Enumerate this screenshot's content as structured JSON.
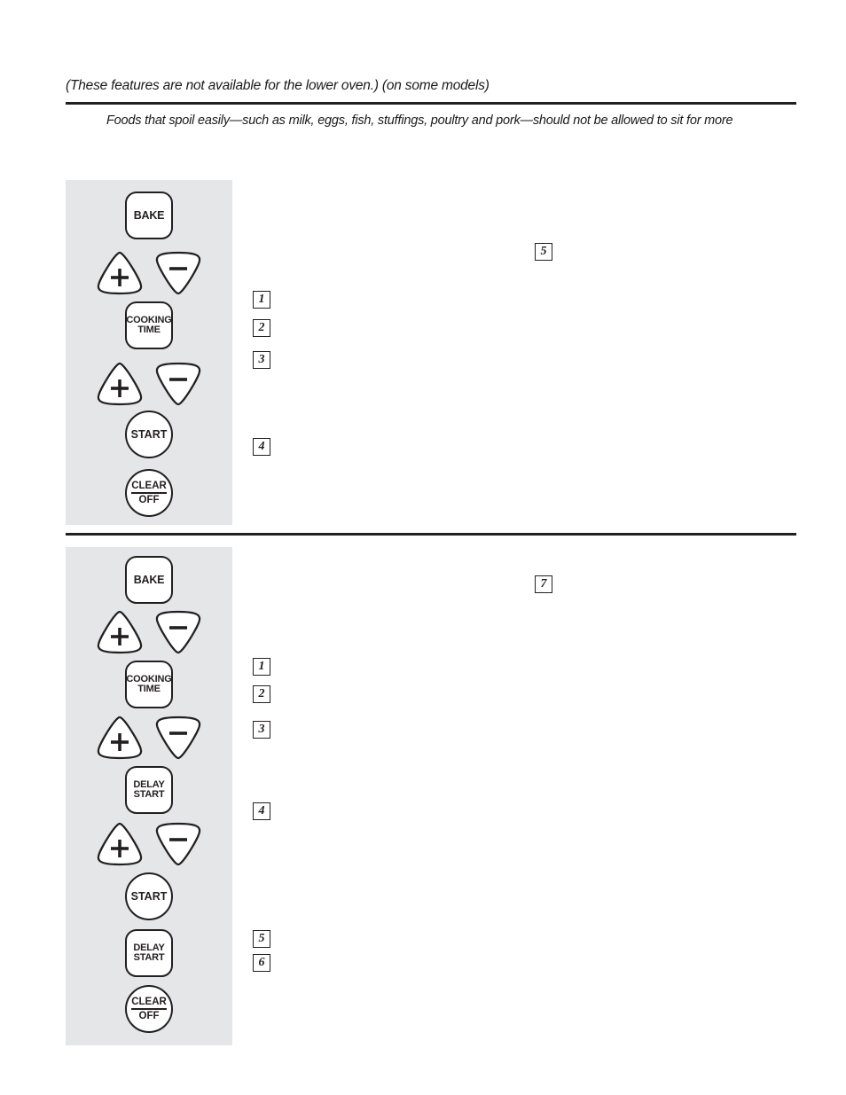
{
  "header": {
    "note": "(These features are not available for the lower oven.) (on some models)",
    "intro": "Foods that spoil easily—such as milk, eggs, fish, stuffings, poultry and pork—should not be allowed to sit for more"
  },
  "sections": [
    {
      "id": "cooking-time-section",
      "panel": {
        "keys": [
          {
            "name": "bake-key",
            "shape": "square",
            "label": "BAKE"
          },
          {
            "name": "plus-key-temp",
            "shape": "plus",
            "label": "+"
          },
          {
            "name": "minus-key-temp",
            "shape": "minus",
            "label": "−"
          },
          {
            "name": "cooking-time-key",
            "shape": "square",
            "label": "COOKING\nTIME"
          },
          {
            "name": "plus-key-time",
            "shape": "plus",
            "label": "+"
          },
          {
            "name": "minus-key-time",
            "shape": "minus",
            "label": "−"
          },
          {
            "name": "start-key",
            "shape": "round",
            "label": "START"
          },
          {
            "name": "clear-off-key",
            "shape": "round",
            "label_top": "CLEAR",
            "label_bottom": "OFF"
          }
        ]
      },
      "steps": [
        {
          "number": "1",
          "text": ""
        },
        {
          "number": "2",
          "text": ""
        },
        {
          "number": "3",
          "text": ""
        },
        {
          "number": "4",
          "text": ""
        },
        {
          "number": "5",
          "text": ""
        }
      ]
    },
    {
      "id": "delay-start-section",
      "panel": {
        "keys": [
          {
            "name": "bake-key",
            "shape": "square",
            "label": "BAKE"
          },
          {
            "name": "plus-key-temp",
            "shape": "plus",
            "label": "+"
          },
          {
            "name": "minus-key-temp",
            "shape": "minus",
            "label": "−"
          },
          {
            "name": "cooking-time-key",
            "shape": "square",
            "label": "COOKING\nTIME"
          },
          {
            "name": "plus-key-time",
            "shape": "plus",
            "label": "+"
          },
          {
            "name": "minus-key-time",
            "shape": "minus",
            "label": "−"
          },
          {
            "name": "delay-start-key",
            "shape": "square",
            "label": "DELAY\nSTART"
          },
          {
            "name": "plus-key-delay",
            "shape": "plus",
            "label": "+"
          },
          {
            "name": "minus-key-delay",
            "shape": "minus",
            "label": "−"
          },
          {
            "name": "start-key",
            "shape": "round",
            "label": "START"
          },
          {
            "name": "delay-start-key-2",
            "shape": "square",
            "label": "DELAY\nSTART"
          },
          {
            "name": "clear-off-key",
            "shape": "round",
            "label_top": "CLEAR",
            "label_bottom": "OFF"
          }
        ]
      },
      "steps": [
        {
          "number": "1",
          "text": ""
        },
        {
          "number": "2",
          "text": ""
        },
        {
          "number": "3",
          "text": ""
        },
        {
          "number": "4",
          "text": ""
        },
        {
          "number": "5",
          "text": ""
        },
        {
          "number": "6",
          "text": ""
        },
        {
          "number": "7",
          "text": ""
        }
      ]
    }
  ],
  "colors": {
    "panel_background": "#e4e6e8",
    "rule": "#231f20",
    "key_outline": "#231f20",
    "key_fill": "#ffffff",
    "text": "#1a1a1a"
  }
}
